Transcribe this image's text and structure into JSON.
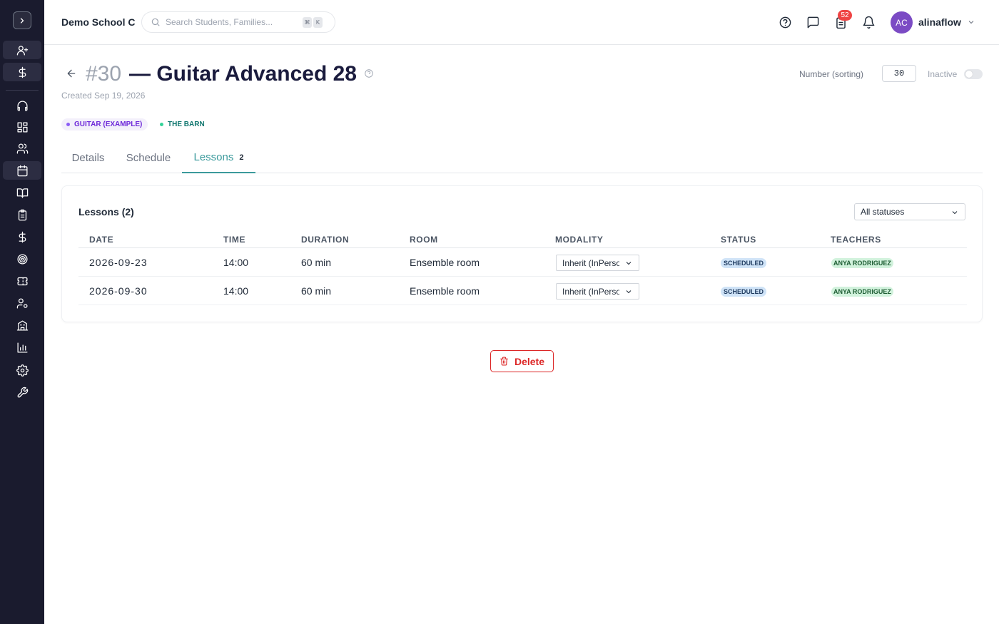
{
  "sidebar": {
    "items": [
      {
        "icon": "user-plus-icon"
      },
      {
        "icon": "dollar-icon"
      },
      {
        "icon": "headset-icon"
      },
      {
        "icon": "dashboard-icon"
      },
      {
        "icon": "users-icon"
      },
      {
        "icon": "calendar-icon"
      },
      {
        "icon": "book-icon"
      },
      {
        "icon": "clipboard-icon"
      },
      {
        "icon": "dollar-icon"
      },
      {
        "icon": "target-icon"
      },
      {
        "icon": "ticket-icon"
      },
      {
        "icon": "user-gear-icon"
      },
      {
        "icon": "building-icon"
      },
      {
        "icon": "chart-icon"
      },
      {
        "icon": "gear-icon"
      },
      {
        "icon": "wrench-icon"
      }
    ]
  },
  "header": {
    "school": "Demo School C",
    "search_placeholder": "Search Students, Families...",
    "kbd1": "⌘",
    "kbd2": "K",
    "notif_count": "52",
    "avatar_initials": "AC",
    "username": "alinaflow"
  },
  "page": {
    "number": "#30",
    "title": "— Guitar Advanced 28",
    "created": "Created Sep 19, 2026",
    "sort_label": "Number (sorting)",
    "sort_value": "30",
    "inactive_label": "Inactive",
    "tags": [
      "GUITAR (EXAMPLE)",
      "THE BARN"
    ],
    "tabs": [
      {
        "label": "Details"
      },
      {
        "label": "Schedule"
      },
      {
        "label": "Lessons",
        "count": "2"
      }
    ],
    "active_tab": "Lessons"
  },
  "lessons": {
    "title": "Lessons (2)",
    "status_filter": "All statuses",
    "columns": [
      "DATE",
      "TIME",
      "DURATION",
      "ROOM",
      "MODALITY",
      "STATUS",
      "TEACHERS"
    ],
    "rows": [
      {
        "date": "2026-09-23",
        "time": "14:00",
        "duration": "60 min",
        "room": "Ensemble room",
        "modality": "Inherit (InPerson)",
        "status": "SCHEDULED",
        "teacher": "ANYA RODRIGUEZ"
      },
      {
        "date": "2026-09-30",
        "time": "14:00",
        "duration": "60 min",
        "room": "Ensemble room",
        "modality": "Inherit (InPerson)",
        "status": "SCHEDULED",
        "teacher": "ANYA RODRIGUEZ"
      }
    ]
  },
  "actions": {
    "delete_label": "Delete"
  },
  "colors": {
    "sidebar_bg": "#1a1b2e",
    "accent_teal": "#3b9a9c",
    "danger": "#dc2626",
    "avatar": "#7b4bc4"
  }
}
